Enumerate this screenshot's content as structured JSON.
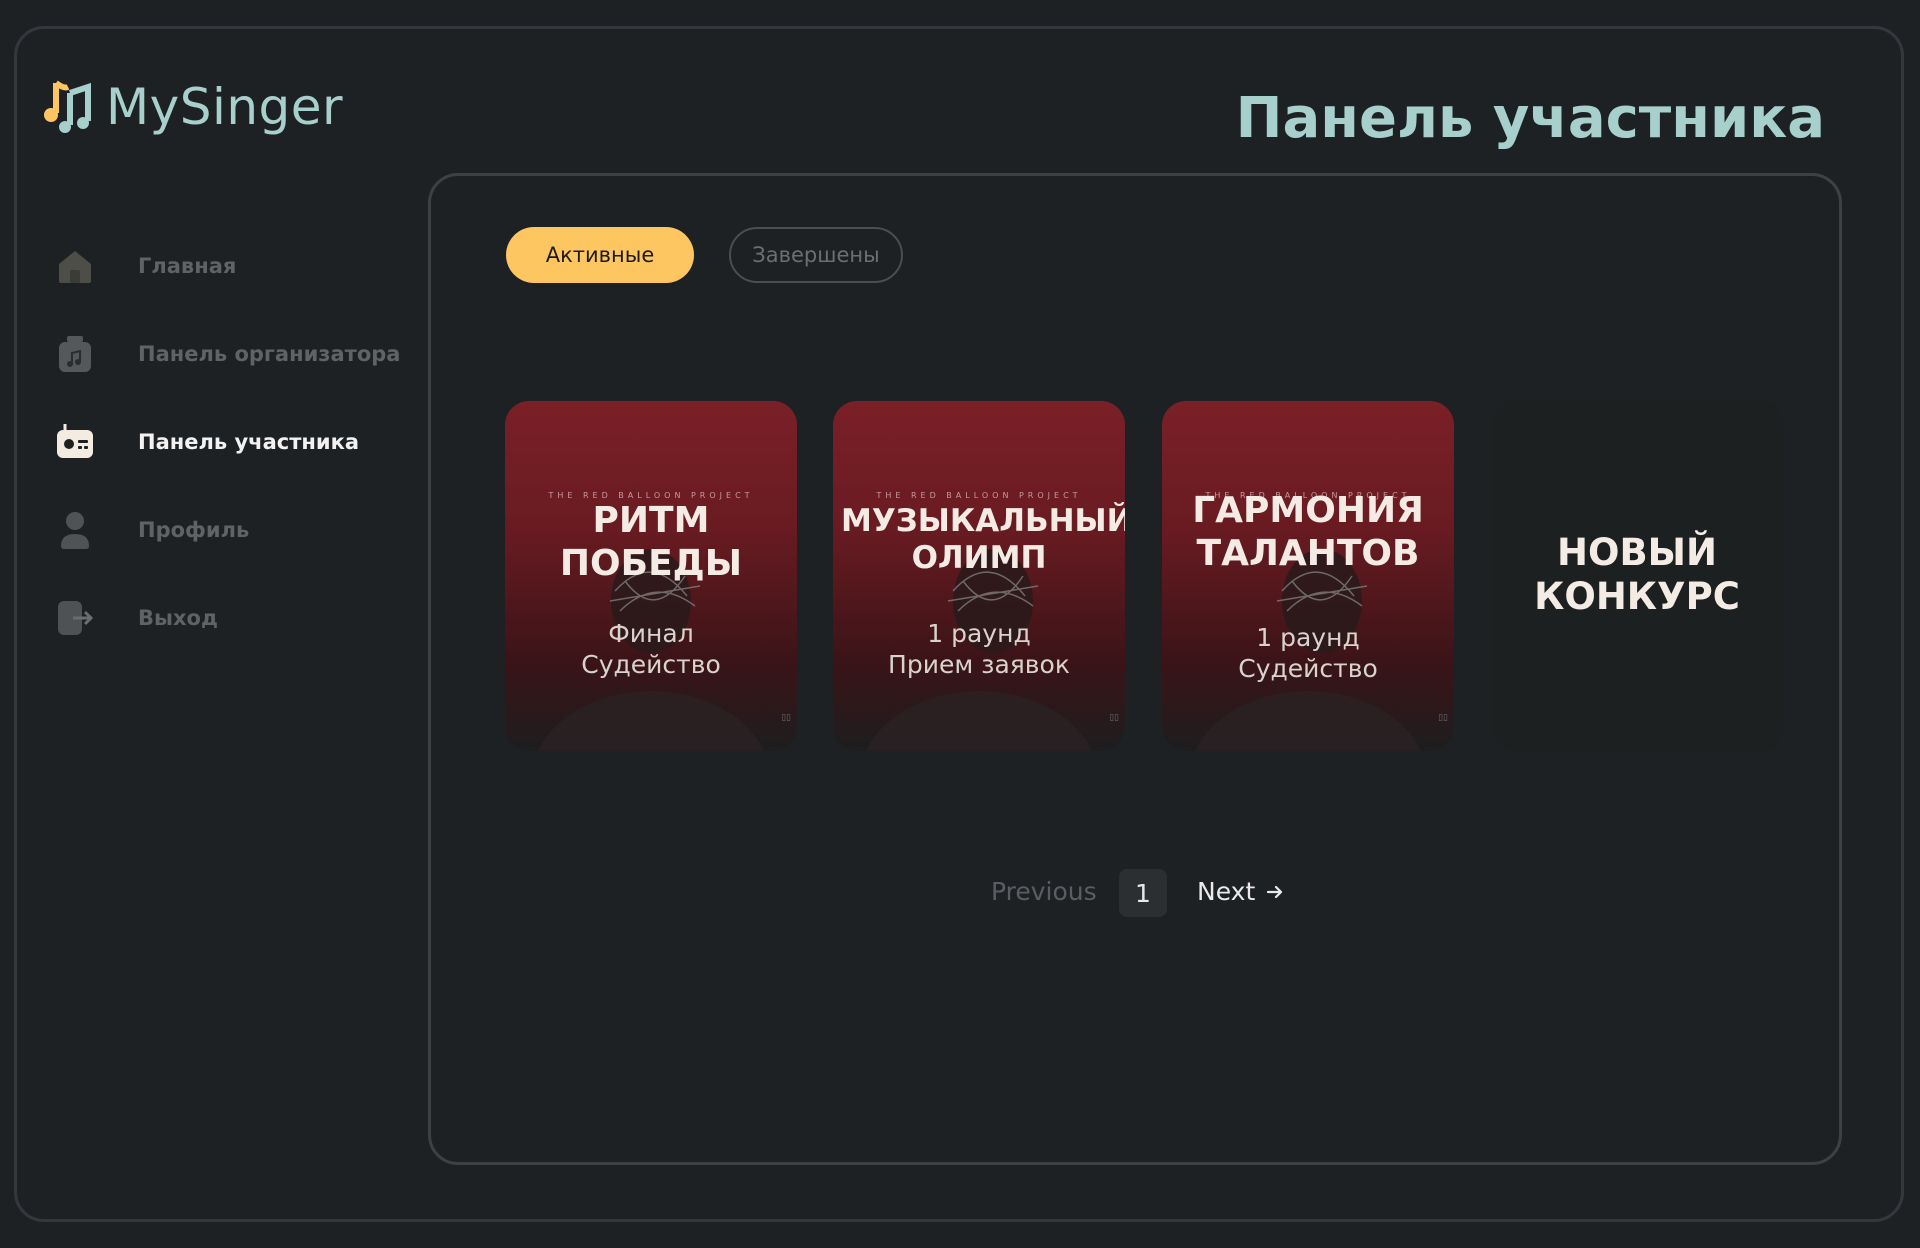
{
  "app": {
    "name": "MySinger"
  },
  "header": {
    "title": "Панель участника"
  },
  "sidebar": {
    "items": [
      {
        "label": "Главная",
        "icon": "home-icon",
        "active": false
      },
      {
        "label": "Панель организатора",
        "icon": "music-file-icon",
        "active": false
      },
      {
        "label": "Панель участника",
        "icon": "radio-icon",
        "active": true
      },
      {
        "label": "Профиль",
        "icon": "user-icon",
        "active": false
      },
      {
        "label": "Выход",
        "icon": "logout-icon",
        "active": false
      }
    ]
  },
  "tabs": {
    "active": "Активные",
    "completed": "Завершены"
  },
  "cards": [
    {
      "kicker": "THE  RED  BALLOON  PROJECT",
      "title": "РИТМ ПОБЕДЫ",
      "status_1": "Финал",
      "status_2": "Судейство"
    },
    {
      "kicker": "THE  RED  BALLOON  PROJECT",
      "title": "МУЗЫКАЛЬНЫЙ ОЛИМП",
      "status_1": "1 раунд",
      "status_2": "Прием заявок"
    },
    {
      "kicker": "THE  RED  BALLOON  PROJECT",
      "title": "ГАРМОНИЯ ТАЛАНТОВ",
      "status_1": "1 раунд",
      "status_2": "Судейство"
    },
    {
      "title": "НОВЫЙ КОНКУРС"
    }
  ],
  "pagination": {
    "previous": "Previous",
    "current": "1",
    "next": "Next"
  },
  "colors": {
    "accent": "#fec660",
    "brand": "#a7cfcc",
    "background": "#1e2124",
    "card_red": "#7a2027"
  }
}
